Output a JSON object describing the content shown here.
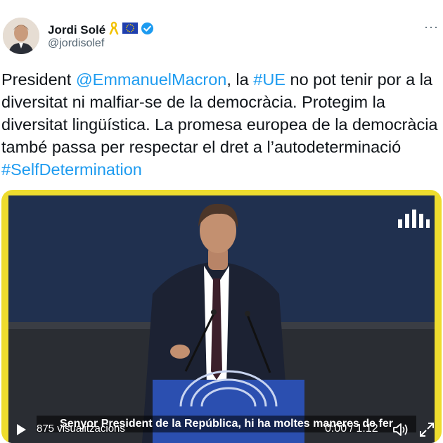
{
  "author": {
    "name": "Jordi Solé",
    "handle": "@jordisolef",
    "badges": [
      "yellow-ribbon-icon",
      "eu-flag-icon",
      "verified-badge-icon"
    ]
  },
  "menu": {
    "more_label": "···"
  },
  "tweet": {
    "segments": [
      {
        "text": "President ",
        "type": "text"
      },
      {
        "text": "@EmmanuelMacron",
        "type": "mention"
      },
      {
        "text": ", la ",
        "type": "text"
      },
      {
        "text": "#UE",
        "type": "hashtag"
      },
      {
        "text": " no pot tenir por a la diversitat ni malfiar-se de la democràcia. Protegim la diversitat lingüística. La promesa europea de la democràcia també passa per respectar el dret a l’autodeterminació ",
        "type": "text"
      },
      {
        "text": "#SelfDetermination",
        "type": "hashtag"
      }
    ]
  },
  "video": {
    "subtitle": "Senyor President de la República, hi ha moltes maneres de fer",
    "views": "875 visualitzacions",
    "time": "0:00 / 1:12"
  },
  "colors": {
    "link": "#1d9bf0",
    "frame": "#eedc2e",
    "video_bg": "#1f2a44"
  }
}
